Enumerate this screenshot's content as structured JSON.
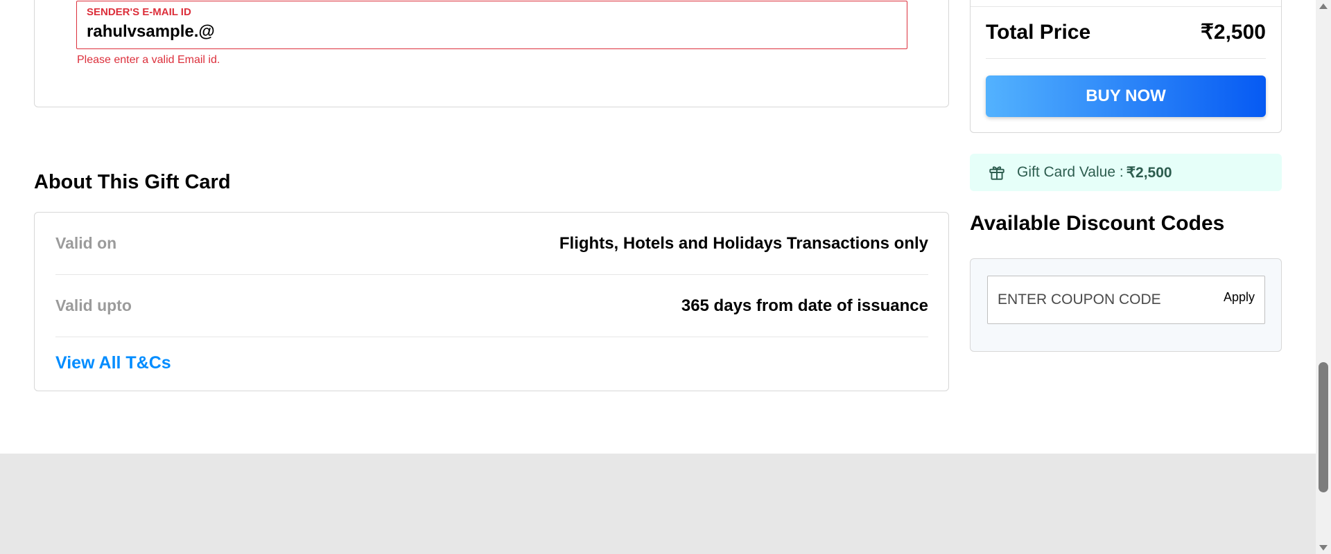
{
  "sender": {
    "email_label": "SENDER'S E-MAIL ID",
    "email_value": "rahulvsample.@",
    "error_message": "Please enter a valid Email id."
  },
  "about": {
    "title": "About This Gift Card",
    "rows": [
      {
        "label": "Valid on",
        "value": "Flights, Hotels and Holidays Transactions only"
      },
      {
        "label": "Valid upto",
        "value": "365 days from date of issuance"
      }
    ],
    "tnc_link": "View All T&Cs"
  },
  "price": {
    "label": "Total Price",
    "value": "₹2,500",
    "buy_button": "BUY NOW"
  },
  "gift_card_value": {
    "icon": "gift-icon",
    "label": "Gift Card Value :",
    "amount": "₹2,500"
  },
  "discount": {
    "title": "Available Discount Codes",
    "coupon_placeholder": "ENTER COUPON CODE",
    "apply_button": "Apply"
  },
  "colors": {
    "error": "#dc2f3b",
    "link": "#008cff",
    "buy_gradient_start": "#53b2fe",
    "buy_gradient_end": "#065af3",
    "gift_value_bg": "#e6fff9"
  }
}
